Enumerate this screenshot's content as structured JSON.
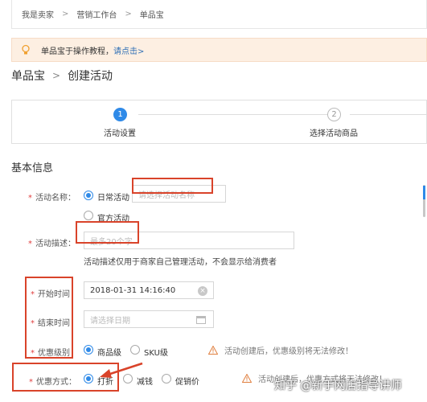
{
  "breadcrumb": {
    "items": [
      "我是卖家",
      "营销工作台",
      "单品宝"
    ],
    "separator": ">"
  },
  "tip": {
    "text": "单品宝于操作教程，",
    "link": "请点击>"
  },
  "page_heading": {
    "parent": "单品宝",
    "separator": ">",
    "current": "创建活动"
  },
  "steps": [
    {
      "number": "1",
      "label": "活动设置",
      "active": true
    },
    {
      "number": "2",
      "label": "选择活动商品",
      "active": false
    }
  ],
  "section_title": "基本信息",
  "form": {
    "activity_name": {
      "label": "活动名称：",
      "options": [
        "日常活动",
        "官方活动"
      ],
      "selected": "日常活动",
      "placeholder": "请选择活动名称"
    },
    "activity_desc": {
      "label": "活动描述：",
      "placeholder": "最多20个字",
      "hint": "活动描述仅用于商家自己管理活动，不会显示给消费者"
    },
    "start_time": {
      "label": "开始时间",
      "value": "2018-01-31 14:16:40"
    },
    "end_time": {
      "label": "结束时间",
      "placeholder": "请选择日期"
    },
    "discount_level": {
      "label": "优惠级别",
      "options": [
        "商品级",
        "SKU级"
      ],
      "selected": "商品级",
      "warning": "活动创建后，优惠级别将无法修改！"
    },
    "discount_method": {
      "label": "优惠方式：",
      "options": [
        "打折",
        "减钱",
        "促销价"
      ],
      "selected": "打折",
      "warning": "活动创建后，优惠方式将无法修改！"
    }
  },
  "watermark": "知乎 @新手网店指导讲师",
  "colors": {
    "accent": "#2f8ae8",
    "highlight": "#d9432a",
    "required": "#e04040",
    "tip_bg": "#fdefe2"
  },
  "icons": [
    "bulb-icon",
    "clear-icon",
    "calendar-icon",
    "warning-icon",
    "arrow-icon"
  ]
}
